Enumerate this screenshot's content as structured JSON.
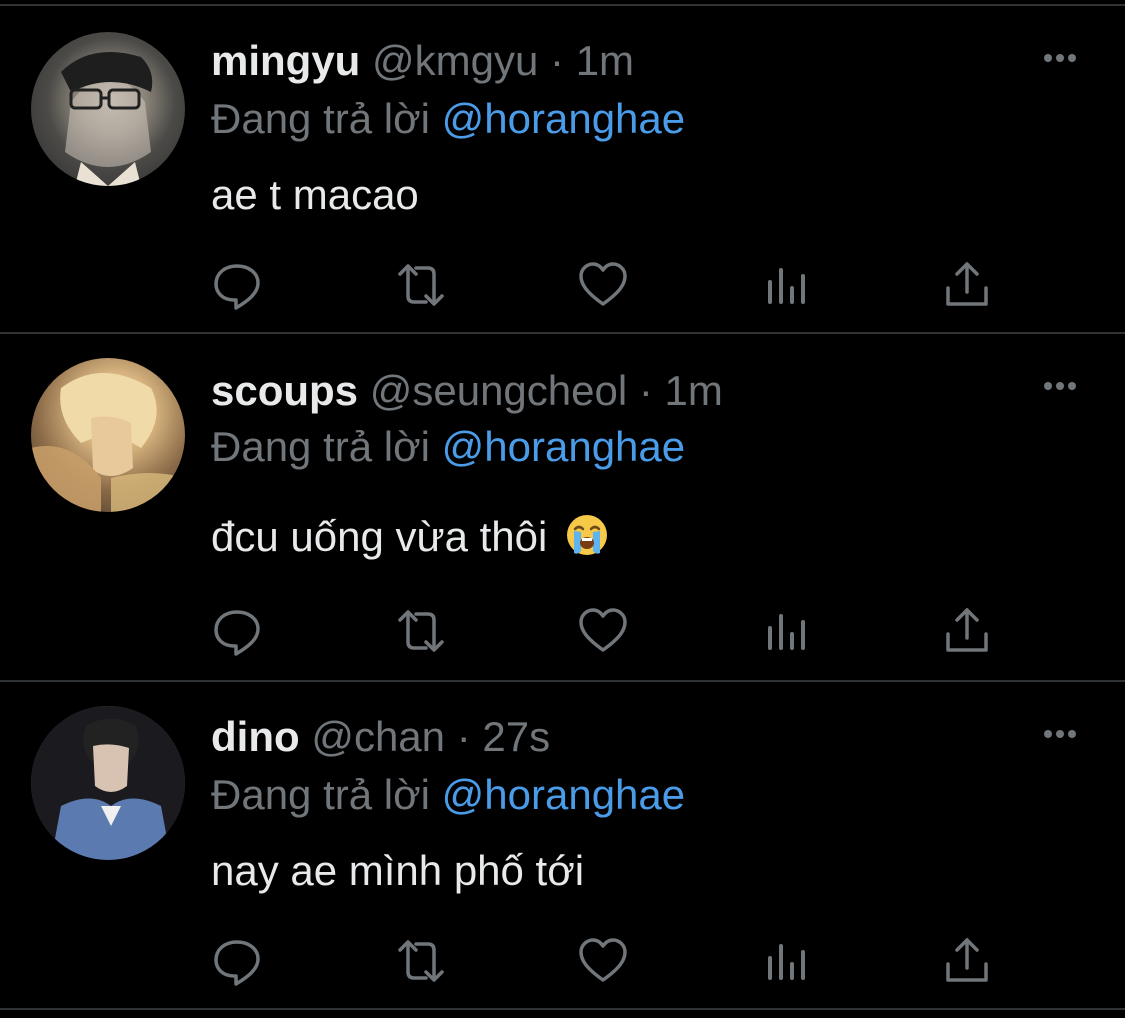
{
  "tweets": [
    {
      "name": "mingyu",
      "handle": "@kmgyu",
      "separator": "·",
      "time": "1m",
      "reply_prefix": "Đang trả lời",
      "reply_to": "@horanghae",
      "text": "ae t macao",
      "emoji": ""
    },
    {
      "name": "scoups",
      "handle": "@seungcheol",
      "separator": "·",
      "time": "1m",
      "reply_prefix": "Đang trả lời",
      "reply_to": "@horanghae",
      "text": "đcu uống vừa thôi",
      "emoji": "loudly-crying-face"
    },
    {
      "name": "dino",
      "handle": "@chan",
      "separator": "·",
      "time": "27s",
      "reply_prefix": "Đang trả lời",
      "reply_to": "@horanghae",
      "text": "nay ae mình phố tới",
      "emoji": ""
    }
  ],
  "icons": {
    "reply": "reply-icon",
    "retweet": "retweet-icon",
    "like": "heart-icon",
    "views": "views-icon",
    "share": "share-icon",
    "more": "more-icon"
  },
  "colors": {
    "background": "#000000",
    "text": "#e7e9ea",
    "muted": "#71767b",
    "mention": "#4a9be8",
    "divider": "#2f3336"
  }
}
